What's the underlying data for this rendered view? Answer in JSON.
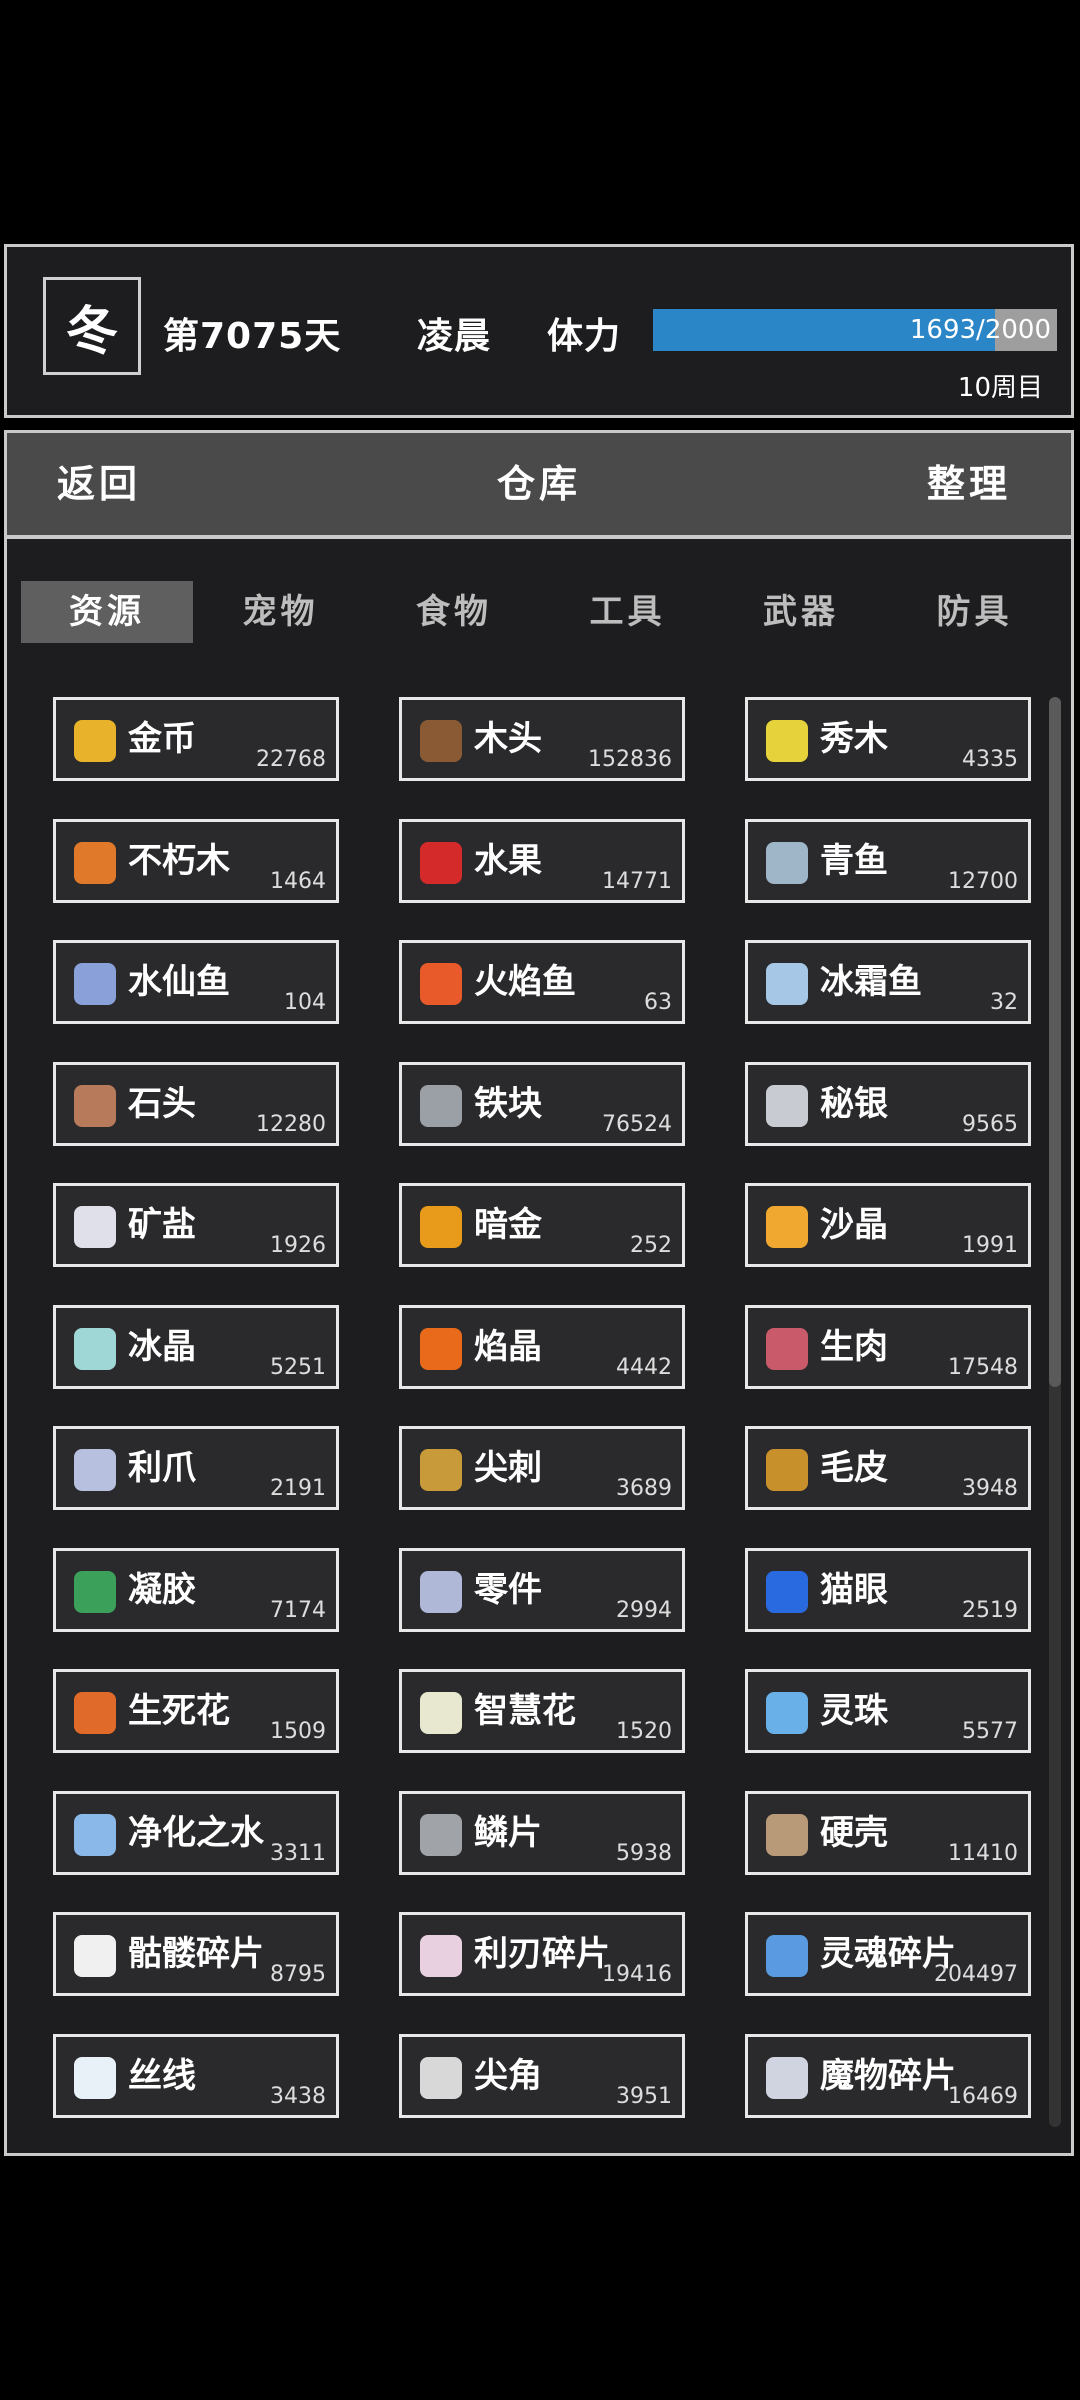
{
  "status": {
    "season": "冬",
    "day_text": "第7075天",
    "time_of_day": "凌晨",
    "stamina_label": "体力",
    "stamina_current": 1693,
    "stamina_max": 2000,
    "stamina_text": "1693/2000",
    "cycle_text": "10周目",
    "colors": {
      "stamina_fill": "#2b86c8",
      "stamina_bg": "#9e9e9e"
    }
  },
  "titlebar": {
    "back_label": "返回",
    "title": "仓库",
    "sort_label": "整理"
  },
  "tabs": [
    {
      "label": "资源",
      "active": true
    },
    {
      "label": "宠物",
      "active": false
    },
    {
      "label": "食物",
      "active": false
    },
    {
      "label": "工具",
      "active": false
    },
    {
      "label": "武器",
      "active": false
    },
    {
      "label": "防具",
      "active": false
    }
  ],
  "items": [
    {
      "name": "金币",
      "count": "22768",
      "icon": "gold-coin-icon",
      "color": "#e8b22a"
    },
    {
      "name": "木头",
      "count": "152836",
      "icon": "wood-log-icon",
      "color": "#8a5a34"
    },
    {
      "name": "秀木",
      "count": "4335",
      "icon": "yellow-flower-icon",
      "color": "#e6d23a"
    },
    {
      "name": "不朽木",
      "count": "1464",
      "icon": "orange-wood-icon",
      "color": "#e07a2a"
    },
    {
      "name": "水果",
      "count": "14771",
      "icon": "apple-icon",
      "color": "#d42a2a"
    },
    {
      "name": "青鱼",
      "count": "12700",
      "icon": "fish-icon",
      "color": "#9fb6c8"
    },
    {
      "name": "水仙鱼",
      "count": "104",
      "icon": "small-fish-icon",
      "color": "#8aa0d8"
    },
    {
      "name": "火焰鱼",
      "count": "63",
      "icon": "fire-fish-icon",
      "color": "#e85a2a"
    },
    {
      "name": "冰霜鱼",
      "count": "32",
      "icon": "ice-fish-icon",
      "color": "#a6c8e6"
    },
    {
      "name": "石头",
      "count": "12280",
      "icon": "rock-icon",
      "color": "#b77a5a"
    },
    {
      "name": "铁块",
      "count": "76524",
      "icon": "iron-bar-icon",
      "color": "#9aa0a6"
    },
    {
      "name": "秘银",
      "count": "9565",
      "icon": "mithril-icon",
      "color": "#c8ccd2"
    },
    {
      "name": "矿盐",
      "count": "1926",
      "icon": "salt-icon",
      "color": "#e0e0ea"
    },
    {
      "name": "暗金",
      "count": "252",
      "icon": "dark-gold-icon",
      "color": "#e89a1a"
    },
    {
      "name": "沙晶",
      "count": "1991",
      "icon": "sand-crystal-icon",
      "color": "#f0a830"
    },
    {
      "name": "冰晶",
      "count": "5251",
      "icon": "ice-crystal-icon",
      "color": "#9fd6d6"
    },
    {
      "name": "焰晶",
      "count": "4442",
      "icon": "fire-crystal-icon",
      "color": "#e86a1a"
    },
    {
      "name": "生肉",
      "count": "17548",
      "icon": "raw-meat-icon",
      "color": "#c85a6a"
    },
    {
      "name": "利爪",
      "count": "2191",
      "icon": "claw-icon",
      "color": "#b8c0e0"
    },
    {
      "name": "尖刺",
      "count": "3689",
      "icon": "spike-icon",
      "color": "#c89a3a"
    },
    {
      "name": "毛皮",
      "count": "3948",
      "icon": "fur-icon",
      "color": "#c8902a"
    },
    {
      "name": "凝胶",
      "count": "7174",
      "icon": "gel-icon",
      "color": "#3aa05a"
    },
    {
      "name": "零件",
      "count": "2994",
      "icon": "part-icon",
      "color": "#b0b8d8"
    },
    {
      "name": "猫眼",
      "count": "2519",
      "icon": "cat-eye-icon",
      "color": "#2a6ae0"
    },
    {
      "name": "生死花",
      "count": "1509",
      "icon": "orange-flower-icon",
      "color": "#e06a2a"
    },
    {
      "name": "智慧花",
      "count": "1520",
      "icon": "white-flower-icon",
      "color": "#e8e8d0"
    },
    {
      "name": "灵珠",
      "count": "5577",
      "icon": "spirit-orb-icon",
      "color": "#6ab0e8"
    },
    {
      "name": "净化之水",
      "count": "3311",
      "icon": "water-swirl-icon",
      "color": "#8ab8e8"
    },
    {
      "name": "鳞片",
      "count": "5938",
      "icon": "scale-icon",
      "color": "#a0a4a8"
    },
    {
      "name": "硬壳",
      "count": "11410",
      "icon": "shell-icon",
      "color": "#b89a78"
    },
    {
      "name": "骷髅碎片",
      "count": "8795",
      "icon": "skull-icon",
      "color": "#f0f0f0"
    },
    {
      "name": "利刃碎片",
      "count": "19416",
      "icon": "blade-icon",
      "color": "#e8d0e0"
    },
    {
      "name": "灵魂碎片",
      "count": "204497",
      "icon": "soul-shard-icon",
      "color": "#5a9ae0"
    },
    {
      "name": "丝线",
      "count": "3438",
      "icon": "thread-icon",
      "color": "#e8f0f8"
    },
    {
      "name": "尖角",
      "count": "3951",
      "icon": "horn-icon",
      "color": "#d8d8d8"
    },
    {
      "name": "魔物碎片",
      "count": "16469",
      "icon": "monster-shard-icon",
      "color": "#d0d4e0"
    }
  ]
}
